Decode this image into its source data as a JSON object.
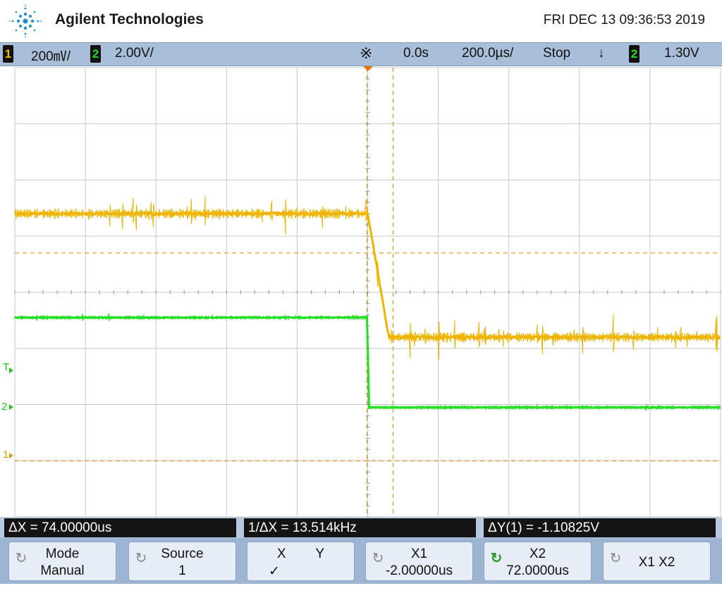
{
  "header": {
    "brand": "Agilent Technologies",
    "datetime": "FRI DEC 13 09:36:53 2019"
  },
  "status": {
    "ch1_num": "1",
    "ch1_scale": "200㎷/",
    "ch2_num": "2",
    "ch2_scale": "2.00V/",
    "trigger_icon": "※",
    "delay": "0.0s",
    "timebase": "200.0µs/",
    "run_state": "Stop",
    "trig_slope": "↓",
    "trig_src": "2",
    "trig_level": "1.30V"
  },
  "markers": {
    "trigger": "T",
    "ch2": "2",
    "ch1": "1"
  },
  "measurements": {
    "dx": "ΔX = 74.00000us",
    "inv_dx": "1/ΔX = 13.514kHz",
    "dy": "ΔY(1) = -1.10825V"
  },
  "softkeys": [
    {
      "l1": "Mode",
      "l2": "Manual"
    },
    {
      "l1": "Source",
      "l2": "1"
    },
    {
      "l1": "X        Y",
      "l2": "✓"
    },
    {
      "l1": "X1",
      "l2": "-2.00000us"
    },
    {
      "l1": "X2",
      "l2": "72.0000us"
    },
    {
      "l1": "X1 X2",
      "l2": ""
    }
  ],
  "colors": {
    "ch1": "#f0b400",
    "ch2": "#22e022",
    "grid": "#c8c8c8",
    "cursor": "#e09020"
  },
  "chart_data": {
    "type": "line",
    "time_per_div_us": 200,
    "divisions_x": 10,
    "divisions_y": 8,
    "series": [
      {
        "name": "1",
        "scale": "200mV/div",
        "before_div": 1.4,
        "after_div": -0.8,
        "transition_us": 20
      },
      {
        "name": "2",
        "scale": "2.00V/div",
        "before_div": -0.45,
        "after_div": -2.05,
        "transition_us": 0
      }
    ],
    "cursors": {
      "x1_us": -2.0,
      "x2_us": 72.0
    }
  }
}
